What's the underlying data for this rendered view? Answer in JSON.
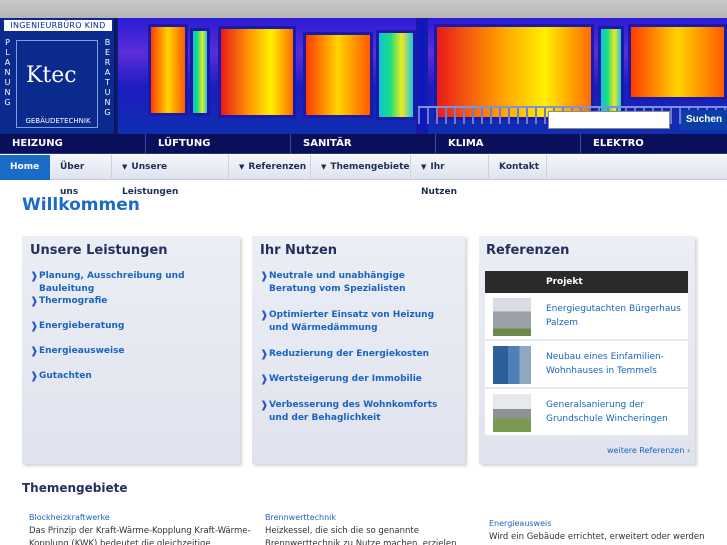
{
  "header": {
    "logo_top": "INGENIEURBÜRO KIND",
    "logo_left_letters": [
      "P",
      "L",
      "A",
      "N",
      "U",
      "N",
      "G"
    ],
    "logo_right_letters": [
      "B",
      "E",
      "R",
      "A",
      "T",
      "U",
      "N",
      "G"
    ],
    "logo_name": "Ktec",
    "logo_bottom": "GEBÄUDETECHNIK",
    "search_placeholder": "",
    "search_button": "Suchen"
  },
  "categories": [
    "HEIZUNG",
    "LÜFTUNG",
    "SANITÄR",
    "KLIMA",
    "ELEKTRO"
  ],
  "nav": [
    {
      "label": "Home",
      "dropdown": false,
      "active": true
    },
    {
      "label": "Über uns",
      "dropdown": false,
      "active": false
    },
    {
      "label": "Unsere Leistungen",
      "dropdown": true,
      "active": false
    },
    {
      "label": "Referenzen",
      "dropdown": true,
      "active": false
    },
    {
      "label": "Themengebiete",
      "dropdown": true,
      "active": false
    },
    {
      "label": "Ihr Nutzen",
      "dropdown": true,
      "active": false
    },
    {
      "label": "Kontakt",
      "dropdown": false,
      "active": false
    }
  ],
  "page_title": "Willkommen",
  "leistungen": {
    "title": "Unsere Leistungen",
    "items": [
      "Planung, Ausschreibung und Bauleitung",
      "Thermografie",
      "Energieberatung",
      "Energieausweise",
      "Gutachten"
    ]
  },
  "nutzen": {
    "title": "Ihr Nutzen",
    "items": [
      "Neutrale und unabhängige Beratung vom Spezialisten",
      "Optimierter Einsatz von Heizung und Wärmedämmung",
      "Reduzierung der Energiekosten",
      "Wertsteigerung der Immobilie",
      "Verbesserung des Wohnkomforts und der Behaglichkeit"
    ]
  },
  "referenzen": {
    "title": "Referenzen",
    "column": "Projekt",
    "rows": [
      "Energiegutachten Bürgerhaus Palzem",
      "Neubau eines Einfamilien-Wohnhauses in Temmels",
      "Generalsanierung der Grundschule Wincheringen"
    ],
    "more": "weitere Referenzen ›"
  },
  "themengebiete": {
    "title": "Themengebiete",
    "items": [
      {
        "title": "Blockheizkraftwerke",
        "text": "Das Prinzip der Kraft-Wärme-Kopplung Kraft-Wärme-Kopplung (KWK) bedeutet die gleichzeitige"
      },
      {
        "title": "Brennwerttechnik",
        "text": "Heizkessel, die sich die so genannte Brennwerttechnik zu Nutze machen, erzielen"
      },
      {
        "title": "Energieausweis",
        "text": "Wird ein Gebäude errichtet, erweitert oder werden"
      }
    ]
  }
}
